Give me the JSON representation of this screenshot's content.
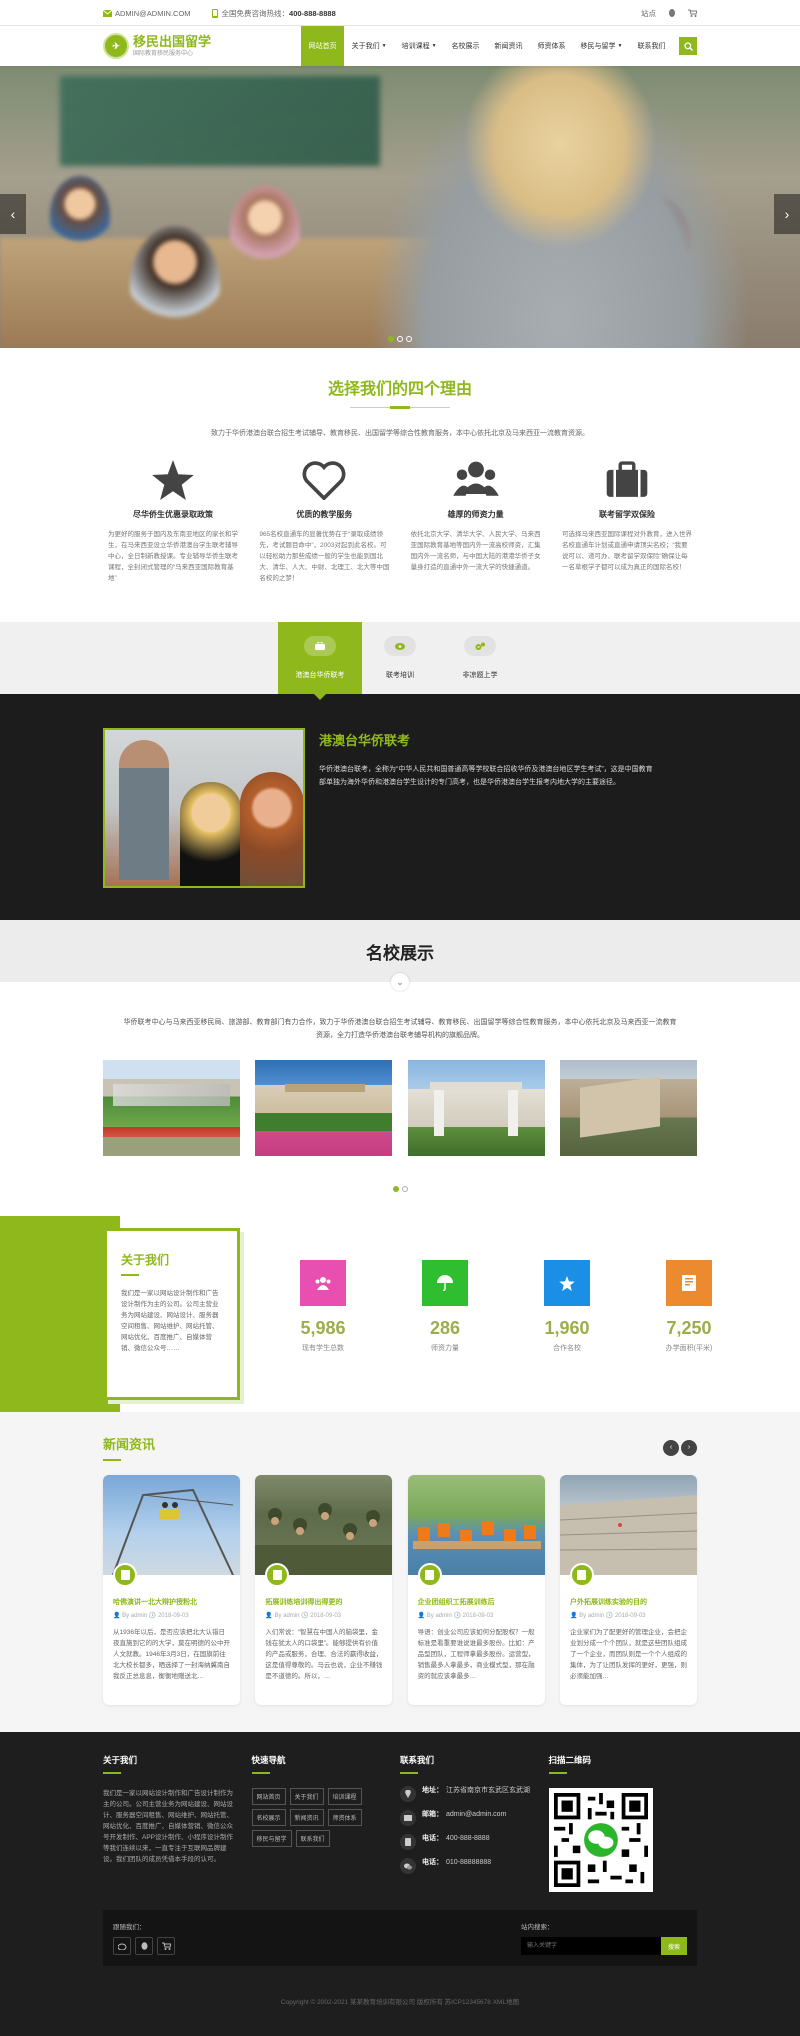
{
  "topbar": {
    "email": "ADMIN@ADMIN.COM",
    "hotline_label": "全国免费咨询热线：",
    "hotline": "400-888-8888",
    "right_link": "站点"
  },
  "logo": {
    "name": "移民出国留学",
    "tagline": "国际教育移民服务中心"
  },
  "nav": [
    "网站首页",
    "关于我们",
    "培训课程",
    "名校展示",
    "新闻资讯",
    "师资体系",
    "移民与留学",
    "联系我们"
  ],
  "hero": {
    "slides": 3,
    "active": 1
  },
  "reasons": {
    "title": "选择我们的四个理由",
    "intro": "致力于华侨港澳台联合招生考试辅导、教育移民、出国留学等综合性教育服务，本中心依托北京及马来西亚一流教育资源。",
    "items": [
      {
        "icon": "star-icon",
        "title": "尽华侨生优惠录取政策",
        "text": "为更好的服务于国内及东南亚地区的家长和学生，在马来西亚设立华侨港澳台学生联考辅导中心，全日制新教授课。专业辅导华侨生联考课程，全封闭式管理的“马来西亚国际教育基地”"
      },
      {
        "icon": "heart-icon",
        "title": "优质的教学服务",
        "text": "965名校直通车的显著优势在于“录取成绩领先，考试题目命中”，2003对起到此名校。可以轻松助力那些成绩一般的学生也能到国北大、清华、人大、中财、北理工、北大等中国名校的之梦！"
      },
      {
        "icon": "users-icon",
        "title": "雄厚的师资力量",
        "text": "依托北京大学、清华大学、人民大学、马来西亚国际教育基地等国内外一流高校师资，汇集国内外一流名师，与中国大陆的港港华侨子女量身打造的直通中外一流大学的快捷通道。"
      },
      {
        "icon": "briefcase-icon",
        "title": "联考留学双保险",
        "text": "可选择马来西亚国际课程对外教育，进入世界名校直通车计划或直通申请顶尖名校；“我要说可以、递可办、联考留学双保险”确保让每一名草根学子都可以成为真正的国际名校！"
      }
    ]
  },
  "tabs": {
    "items": [
      {
        "icon": "briefcase-icon",
        "label": "港澳台华侨联考"
      },
      {
        "icon": "eye-icon",
        "label": "联考培训"
      },
      {
        "icon": "cog-icon",
        "label": "非凉题上学"
      }
    ],
    "active_index": 0,
    "panel": {
      "title": "港澳台华侨联考",
      "text": "华侨港澳台联考，全称为“中华人民共和国普通高等学校联合招收华侨及港澳台地区学生考试”，这是中国教育部单独为海外华侨和港澳台学生设计的专门高考，也是华侨港澳台学生报考内地大学的主要途径。"
    }
  },
  "schools": {
    "title": "名校展示",
    "intro": "华侨联考中心与马来西亚移民局、旅游部、教育部门有力合作，致力于华侨港澳台联合招生考试辅导、教育移民、出国留学等综合性教育服务，本中心依托北京及马来西亚一流教育资源，全力打造华侨港澳台联考辅导机构的旗舰品牌。",
    "count": 4,
    "pages": 2
  },
  "about": {
    "title": "关于我们",
    "text": "我们是一家以网站设计制作和广告设计制作为主的公司。公司主营业务为网站建设、网站设计、服务器空间租售、网站维护、网站托管、网站优化、百度推广、自媒体营销、微信公众号……",
    "stats": [
      {
        "icon": "users-icon",
        "color": "#e94fb0",
        "value": "5,986",
        "label": "现有学生总数"
      },
      {
        "icon": "umbrella-icon",
        "color": "#2fbe2f",
        "value": "286",
        "label": "师资力量"
      },
      {
        "icon": "star-icon",
        "color": "#1b8fe6",
        "value": "1,960",
        "label": "合作名校"
      },
      {
        "icon": "book-icon",
        "color": "#ec8a30",
        "value": "7,250",
        "label": "办学面积(平米)"
      }
    ]
  },
  "news": {
    "title": "新闻资讯",
    "items": [
      {
        "title": "哈佛演讲一北大辩护授粉北",
        "author": "By admin",
        "date": "2018-09-03",
        "text": "从1936年以后，是否应该把北大认错日夜直施到它的的大学，莫在明德的公中开人文就教。1946年3月3日，在国旗前往北大校长都多，晒选择了一封海纳冀南自我反正总息息，衡衡地赠送北…"
      },
      {
        "title": "拓展训练培训得出得更的",
        "author": "By admin",
        "date": "2018-09-03",
        "text": "入们常说：“智慧在中国人的脑袋里，金钱在犹太人的口袋里”。能够提供有价值的产品或服务，合理、合法的赢得收益，这是值得尊敬的。马云也说，企业不赚钱是不道德的。所以，…"
      },
      {
        "title": "企业团组织工拓展训练后",
        "author": "By admin",
        "date": "2018-09-03",
        "text": "导语：创业公司应该如何分配股权？一般标准是看重要谁说谁最多股份。比如：产品型团队，工程师拿最多股份。运营型，销售最多人拿最多，商业模式型，那在融资的就应该拿最多…"
      },
      {
        "title": "户外拓展训练实验的目的",
        "author": "By admin",
        "date": "2018-09-03",
        "text": "企业家们为了配更好的管理企业，会把企业划分成一个个团队，就是这些团队组成了一个企业，而团队则是一个个人组成的集体，为了让团队发挥的更好，更强，则必须能加强…"
      }
    ]
  },
  "footer": {
    "about_title": "关于我们",
    "about_text": "我们是一家以网站设计制作和广告设计制作为主的公司。公司主营业务为网站建设、网站设计、服务器空间租售、网站维护、网站托管、网站优化、百度推广、自媒体营销、微信公众号开发制作、APP设计制作、小程序设计制作等我们连续以来，一直专注于互联网品牌建设。我们团队的成员凭借本手段的认可。",
    "quick_title": "快速导航",
    "quick_links": [
      "网站首页",
      "关于我们",
      "培训课程",
      "名校展示",
      "新闻资讯",
      "师资体系",
      "移民与留学",
      "联系我们"
    ],
    "contact_title": "联系我们",
    "contact": [
      {
        "icon": "map-pin-icon",
        "label": "地址：",
        "value": "江苏省南京市玄武区玄武湖"
      },
      {
        "icon": "mail-icon",
        "label": "邮箱：",
        "value": "admin@admin.com"
      },
      {
        "icon": "phone-icon",
        "label": "电话：",
        "value": "400-888-8888"
      },
      {
        "icon": "wechat-icon",
        "label": "电话：",
        "value": "010-88888888"
      }
    ],
    "qr_title": "扫描二维码",
    "follow_label": "跟随我们：",
    "search_label": "站内搜索：",
    "search_placeholder": "输入关键字",
    "search_button": "搜索",
    "copyright": "Copyright © 2002-2021 某某教育培训有限公司 版权所有 苏ICP12345678 XML地图"
  }
}
